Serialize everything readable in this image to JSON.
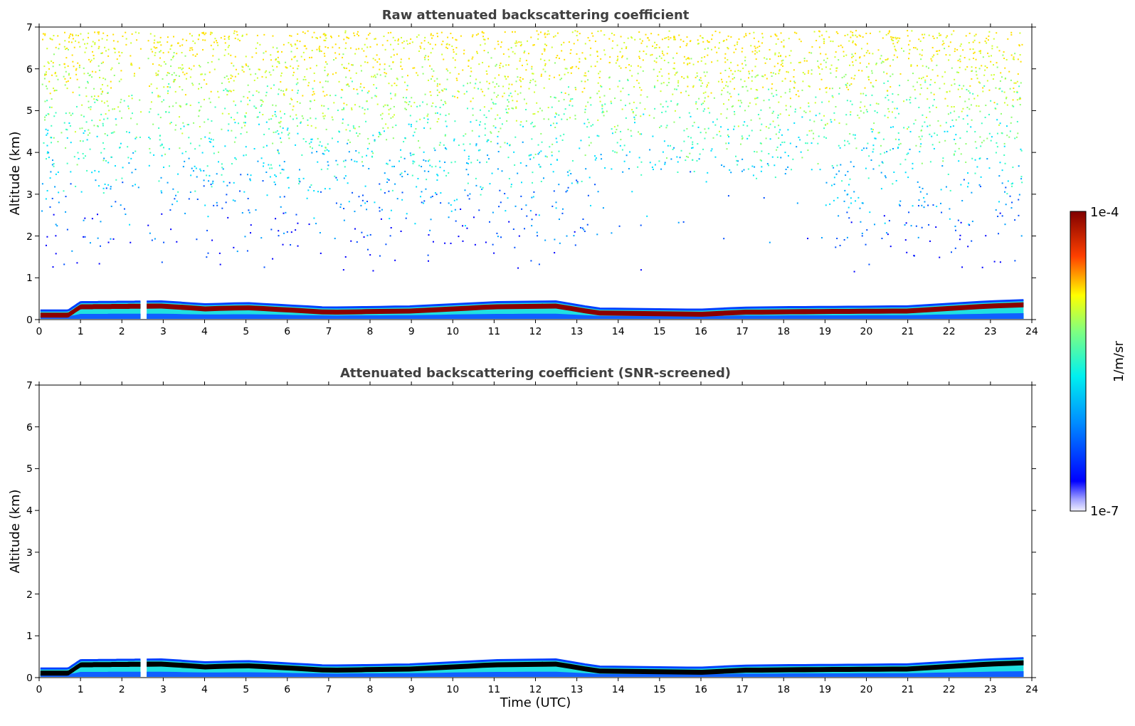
{
  "panels": [
    {
      "kind": "raw",
      "title": "Raw attenuated backscattering coefficient",
      "ylabel": "Altitude (km)",
      "yticks": [
        "7",
        "6",
        "5",
        "4",
        "3",
        "2",
        "1",
        "0"
      ],
      "xticks": [
        "0",
        "1",
        "2",
        "3",
        "4",
        "5",
        "6",
        "7",
        "8",
        "9",
        "10",
        "11",
        "12",
        "13",
        "14",
        "15",
        "16",
        "17",
        "18",
        "19",
        "20",
        "21",
        "22",
        "23",
        "24"
      ]
    },
    {
      "kind": "screened",
      "title": "Attenuated backscattering coefficient (SNR-screened)",
      "ylabel": "Altitude (km)",
      "yticks": [
        "7",
        "6",
        "5",
        "4",
        "3",
        "2",
        "1",
        "0"
      ],
      "xticks": [
        "0",
        "1",
        "2",
        "3",
        "4",
        "5",
        "6",
        "7",
        "8",
        "9",
        "10",
        "11",
        "12",
        "13",
        "14",
        "15",
        "16",
        "17",
        "18",
        "19",
        "20",
        "21",
        "22",
        "23",
        "24"
      ],
      "xlabel": "Time (UTC)"
    }
  ],
  "colorbar": {
    "max_label": "1e-4",
    "min_label": "1e-7",
    "unit": "1/m/sr"
  }
}
